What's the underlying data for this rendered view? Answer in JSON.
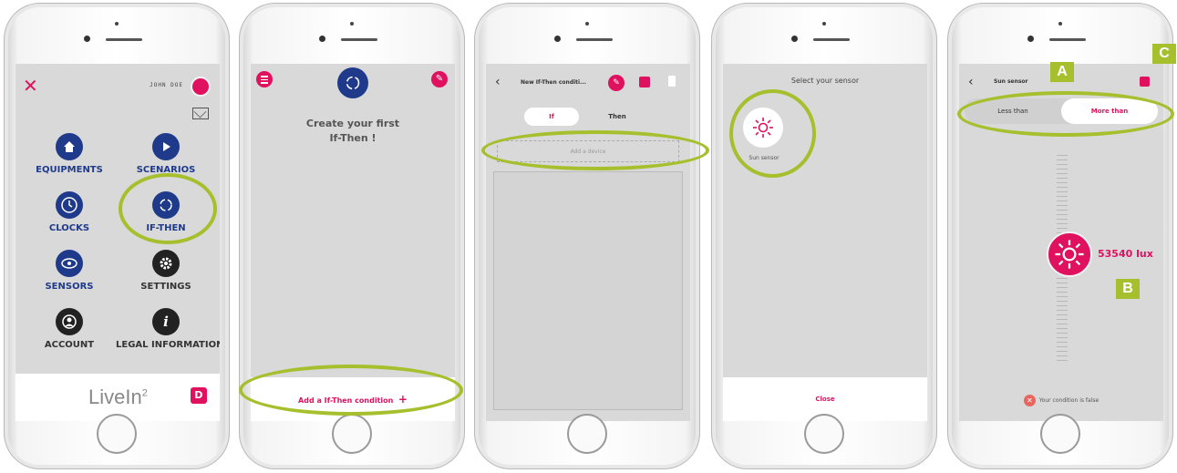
{
  "colors": {
    "accent": "#e0115f",
    "navy": "#1f3a8a",
    "annotation": "#a6bf2d",
    "error": "#e8665f"
  },
  "screen1": {
    "close_icon": "close-icon",
    "user_name": "JOHN DOE",
    "menu": [
      {
        "label": "EQUIPMENTS",
        "icon": "home-icon"
      },
      {
        "label": "SCENARIOS",
        "icon": "play-icon"
      },
      {
        "label": "CLOCKS",
        "icon": "clock-icon"
      },
      {
        "label": "IF-THEN",
        "icon": "if-then-icon"
      },
      {
        "label": "SENSORS",
        "icon": "eye-icon"
      },
      {
        "label": "SETTINGS",
        "icon": "gear-icon"
      },
      {
        "label": "ACCOUNT",
        "icon": "user-icon"
      },
      {
        "label": "LEGAL INFORMATION",
        "icon": "info-icon"
      }
    ],
    "logo_text": "LiveIn",
    "logo_sup": "2"
  },
  "screen2": {
    "title_line1": "Create your first",
    "title_line2": "If-Then !",
    "add_label": "Add a If-Then condition",
    "add_symbol": "+"
  },
  "screen3": {
    "back": "‹",
    "title": "New If-Then conditi...",
    "tabs": [
      "If",
      "Then"
    ],
    "add_device": "Add a device"
  },
  "screen4": {
    "title": "Select your sensor",
    "sensor_label": "Sun sensor",
    "close_label": "Close"
  },
  "screen5": {
    "back": "‹",
    "title": "Sun sensor",
    "options": [
      "Less than",
      "More than"
    ],
    "value": "53540 lux",
    "status": "Your condition is false"
  },
  "annotations": {
    "a": "A",
    "b": "B",
    "c": "C"
  }
}
